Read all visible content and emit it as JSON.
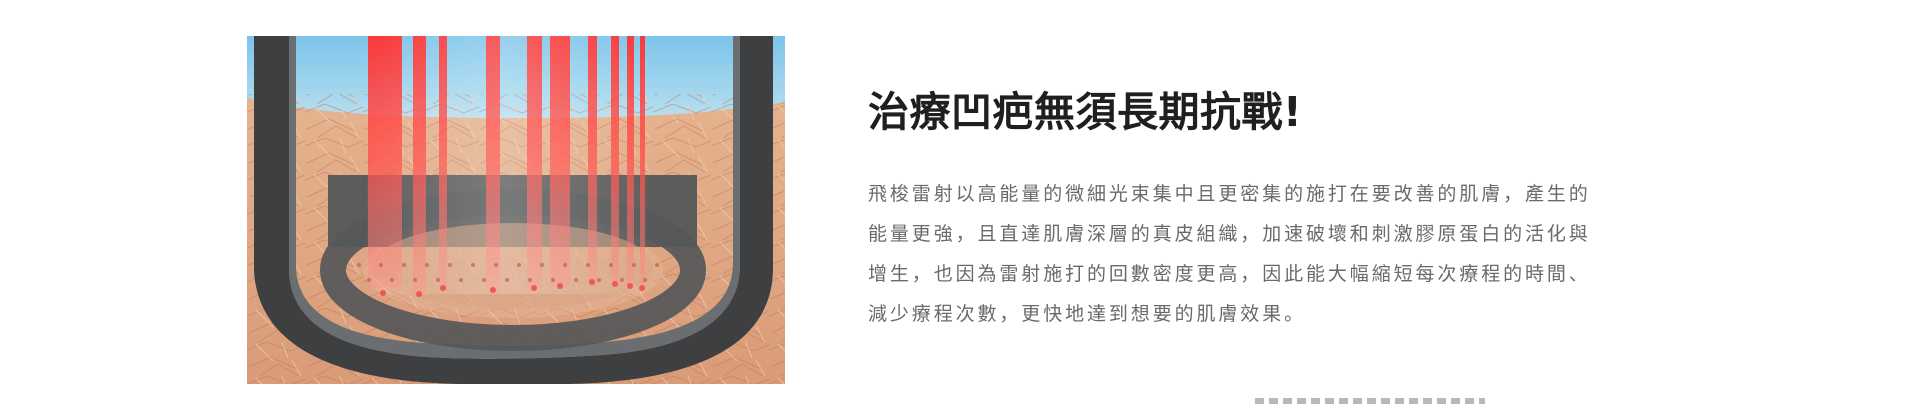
{
  "section": {
    "headline": "治療凹疤無須長期抗戰!",
    "body": "飛梭雷射以高能量的微細光束集中且更密集的施打在要改善的肌膚，產生的能量更強，且直達肌膚深層的真皮組織，加速破壞和刺激膠原蛋白的活化與增生，也因為雷射施打的回數密度更高，因此能大幅縮短每次療程的時間、減少療程次數，更快地達到想要的肌膚效果。"
  },
  "colors": {
    "headline": "#1f1f1f",
    "body": "#6a6a6a",
    "laser": "#ff3b33",
    "sky": "#87c7e8",
    "skin": "#e7b08a",
    "device": "#3f4143"
  }
}
